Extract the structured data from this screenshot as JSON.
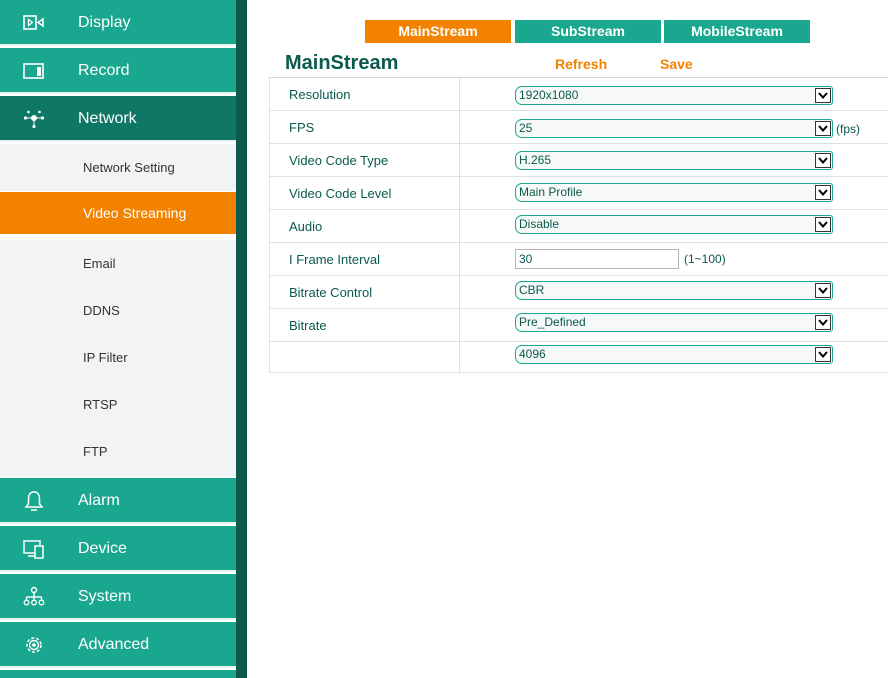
{
  "sidebar": {
    "items": [
      {
        "label": "Display",
        "icon": "display-icon"
      },
      {
        "label": "Record",
        "icon": "record-icon"
      },
      {
        "label": "Network",
        "icon": "network-icon"
      },
      {
        "label": "Alarm",
        "icon": "bell-icon"
      },
      {
        "label": "Device",
        "icon": "device-icon"
      },
      {
        "label": "System",
        "icon": "system-tree-icon"
      },
      {
        "label": "Advanced",
        "icon": "gear-icon"
      }
    ],
    "network_subitems": [
      "Network Setting",
      "Video Streaming",
      "Email",
      "DDNS",
      "IP Filter",
      "RTSP",
      "FTP"
    ],
    "active_subitem": "Video Streaming"
  },
  "tabs": [
    "MainStream",
    "SubStream",
    "MobileStream"
  ],
  "active_tab": "MainStream",
  "page": {
    "title": "MainStream",
    "refresh_label": "Refresh",
    "save_label": "Save"
  },
  "form": {
    "resolution": {
      "label": "Resolution",
      "value": "1920x1080"
    },
    "fps": {
      "label": "FPS",
      "value": "25",
      "unit": "(fps)"
    },
    "video_code_type": {
      "label": "Video Code Type",
      "value": "H.265"
    },
    "video_code_level": {
      "label": "Video Code Level",
      "value": "Main Profile"
    },
    "audio": {
      "label": "Audio",
      "value": "Disable"
    },
    "i_frame_interval": {
      "label": "I Frame Interval",
      "value": "30",
      "range": "(1~100)"
    },
    "bitrate_control": {
      "label": "Bitrate Control",
      "value": "CBR"
    },
    "bitrate": {
      "label": "Bitrate",
      "value": "Pre_Defined"
    },
    "bitrate_value": {
      "label": "",
      "value": "4096"
    }
  },
  "colors": {
    "brand_teal": "#1aa78f",
    "dark_teal": "#0f7766",
    "accent_orange": "#f28200"
  }
}
